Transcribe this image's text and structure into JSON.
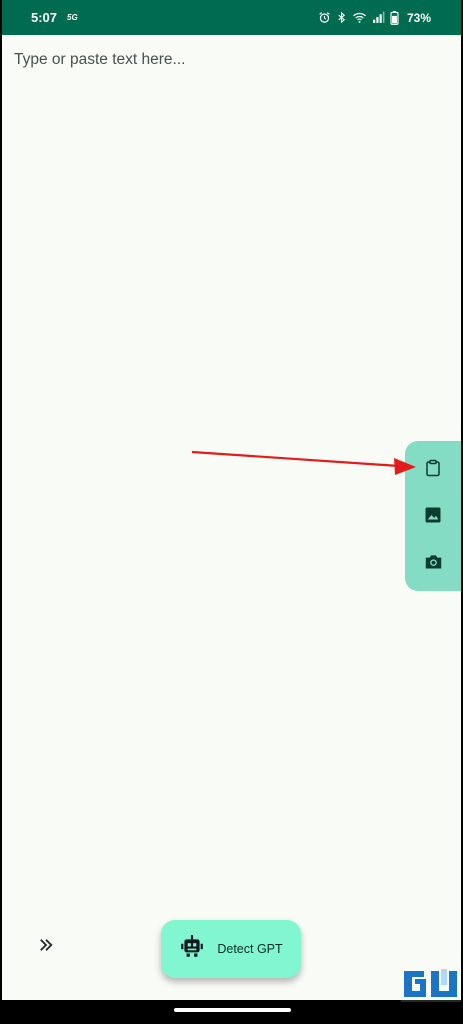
{
  "status_bar": {
    "time": "5:07",
    "network_badge": "5G",
    "battery_percent": "73%",
    "background_color": "#006b4f",
    "icons": [
      "alarm-icon",
      "bluetooth-icon",
      "wifi-icon",
      "signal-icon",
      "battery-icon"
    ]
  },
  "editor": {
    "placeholder": "Type or paste text here...",
    "value": ""
  },
  "side_actions": {
    "background_color": "#83dcc3",
    "items": [
      {
        "name": "paste-clipboard",
        "icon": "clipboard-icon"
      },
      {
        "name": "pick-image",
        "icon": "image-icon"
      },
      {
        "name": "take-photo",
        "icon": "camera-icon"
      }
    ]
  },
  "expand_control": {
    "icon": "double-chevron-right-icon"
  },
  "detect_button": {
    "label": "Detect GPT",
    "icon": "robot-icon",
    "background_color": "#82f6d0"
  },
  "annotation": {
    "arrow_color": "#e21b1b",
    "points_to": "clipboard-icon"
  }
}
